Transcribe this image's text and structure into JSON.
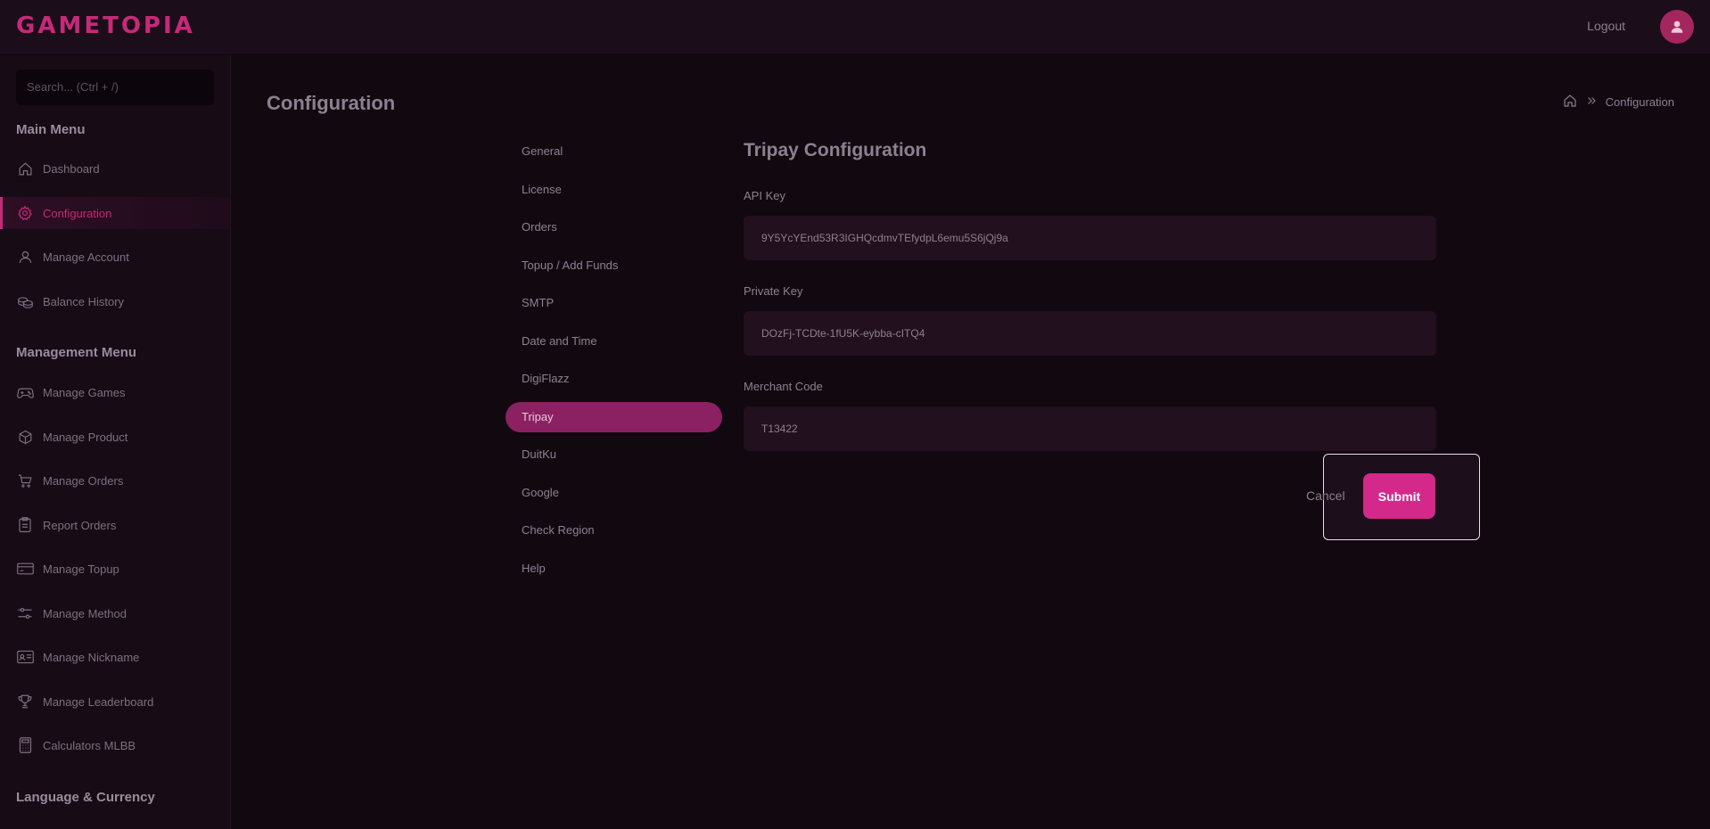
{
  "brand": {
    "logo_text": "GAMETOPIA",
    "accent": "#c52a78"
  },
  "header": {
    "logout_label": "Logout"
  },
  "sidebar": {
    "search_placeholder": "Search... (Ctrl + /)",
    "main_menu_title": "Main Menu",
    "main_menu": [
      {
        "label": "Dashboard",
        "icon": "home-icon"
      },
      {
        "label": "Configuration",
        "icon": "gear-icon",
        "active": true
      },
      {
        "label": "Manage Account",
        "icon": "user-icon"
      },
      {
        "label": "Balance History",
        "icon": "coins-icon"
      }
    ],
    "management_menu_title": "Management Menu",
    "management_menu": [
      {
        "label": "Manage Games",
        "icon": "gamepad-icon"
      },
      {
        "label": "Manage Product",
        "icon": "box-icon"
      },
      {
        "label": "Manage Orders",
        "icon": "cart-icon"
      },
      {
        "label": "Report Orders",
        "icon": "clipboard-icon"
      },
      {
        "label": "Manage Topup",
        "icon": "wallet-icon"
      },
      {
        "label": "Manage Method",
        "icon": "sliders-icon"
      },
      {
        "label": "Manage Nickname",
        "icon": "id-card-icon"
      },
      {
        "label": "Manage Leaderboard",
        "icon": "trophy-icon"
      },
      {
        "label": "Calculators MLBB",
        "icon": "calculator-icon"
      }
    ],
    "language_title": "Language & Currency"
  },
  "page": {
    "title": "Configuration",
    "breadcrumb_current": "Configuration"
  },
  "config_nav": [
    {
      "label": "General"
    },
    {
      "label": "License"
    },
    {
      "label": "Orders"
    },
    {
      "label": "Topup / Add Funds"
    },
    {
      "label": "SMTP"
    },
    {
      "label": "Date and Time"
    },
    {
      "label": "DigiFlazz"
    },
    {
      "label": "Tripay",
      "active": true
    },
    {
      "label": "DuitKu"
    },
    {
      "label": "Google"
    },
    {
      "label": "Check Region"
    },
    {
      "label": "Help"
    }
  ],
  "form": {
    "title": "Tripay Configuration",
    "api_key_label": "API Key",
    "api_key_value": "9Y5YcYEnd53R3IGHQcdmvTEfydpL6emu5S6jQj9a",
    "private_key_label": "Private Key",
    "private_key_value": "DOzFj-TCDte-1fU5K-eybba-cITQ4",
    "merchant_code_label": "Merchant Code",
    "merchant_code_value": "T13422",
    "cancel_label": "Cancel",
    "submit_label": "Submit"
  }
}
